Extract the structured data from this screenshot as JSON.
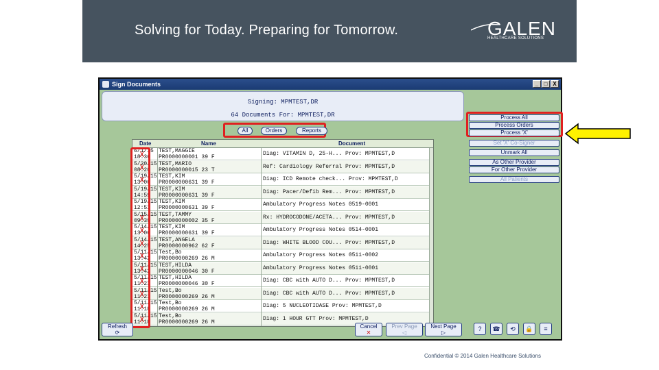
{
  "slide": {
    "tagline": "Solving for Today. Preparing for Tomorrow.",
    "logo_word": "GALEN",
    "logo_sub": "HEALTHCARE SOLUTIONS",
    "footer": "Confidential © 2014 Galen Healthcare Solutions"
  },
  "window": {
    "title": "Sign Documents",
    "controls": [
      "_",
      "□",
      "X"
    ],
    "signing_label": "Signing: MPMTEST,DR",
    "doc_count": "64 Documents For: MPMTEST,DR"
  },
  "filters": [
    "All",
    "Orders",
    "Reports"
  ],
  "grid": {
    "columns": [
      "Date",
      "Name",
      "Document"
    ],
    "rows": [
      {
        "x": "X",
        "date": "6/1/15",
        "time": "18:36",
        "name": "TEST,MAGGIE",
        "id": "PR0000000001 39 F",
        "doc": "Diag:  VITAMIN D, 25-H... Prov: MPMTEST,D"
      },
      {
        "x": "X",
        "date": "5/20/15",
        "time": "08:20",
        "name": "TEST,MARIO",
        "id": "PR0000000015 23 T",
        "doc": "Ref:  Cardiology Referral Prov: MPMTEST,D"
      },
      {
        "x": "X",
        "date": "5/19/15",
        "time": "13:06",
        "name": "TEST,KIM",
        "id": "PR0000000631 39 F",
        "doc": "Diag:  ICD Remote check... Prov: MPMTEST,D"
      },
      {
        "x": "",
        "date": "5/19/15",
        "time": "14:59",
        "name": "TEST,KIM",
        "id": "PR0000000631 39 F",
        "doc": "Diag:  Pacer/Defib Rem... Prov: MPMTEST,D"
      },
      {
        "x": "",
        "date": "5/19/15",
        "time": "12:51",
        "name": "TEST,KIM",
        "id": "PR0000000631 39 F",
        "doc": "Ambulatory  Progress Notes 0519-0001"
      },
      {
        "x": "X",
        "date": "5/15/15",
        "time": "09:39",
        "name": "TEST,TAMMY",
        "id": "PR0000000002 35 F",
        "doc": "Rx:  HYDROCODONE/ACETA... Prov: MPMTEST,D"
      },
      {
        "x": "X",
        "date": "5/14/15",
        "time": "13:06",
        "name": "TEST,KIM",
        "id": "PR0000000631 39 F",
        "doc": "Ambulatory  Progress Notes 0514-0001"
      },
      {
        "x": "X",
        "date": "5/14/15",
        "time": "14:25",
        "name": "TEST,ANGELA",
        "id": "PR0000000962 62 F",
        "doc": "Diag:  WHITE BLOOD COU... Prov: MPMTEST,D"
      },
      {
        "x": "X",
        "date": "5/11/15",
        "time": "13:42",
        "name": "Test,Bo",
        "id": "PR0000000269 26 M",
        "doc": "Ambulatory  Progress Notes 0511-0002"
      },
      {
        "x": "X",
        "date": "5/11/15",
        "time": "13:42",
        "name": "TEST,HILDA",
        "id": "PR0000000046 30 F",
        "doc": "Ambulatory  Progress Notes 0511-0001"
      },
      {
        "x": "X",
        "date": "5/11/15",
        "time": "11:23",
        "name": "TEST,HILDA",
        "id": "PR0000000046 30 F",
        "doc": "Diag:  CBC with AUTO D... Prov: MPMTEST,D"
      },
      {
        "x": "X",
        "date": "5/11/15",
        "time": "11:21",
        "name": "Test,Bo",
        "id": "PR0000000269 26 M",
        "doc": "Diag:  CBC with AUTO D... Prov: MPMTEST,D"
      },
      {
        "x": "X",
        "date": "5/11/15",
        "time": "11:18",
        "name": "Test,Bo",
        "id": "PR0000000269 26 M",
        "doc": "Diag:  5 NUCLEOTIDASE   Prov: MPMTEST,D"
      },
      {
        "x": "X",
        "date": "5/11/15",
        "time": "11:18",
        "name": "Test,Bo",
        "id": "PR0000000269 26 M",
        "doc": "Diag:  1 HOUR GTT      Prov: MPMTEST,D"
      }
    ]
  },
  "side_buttons": [
    {
      "label": "Process All",
      "faded": false
    },
    {
      "label": "Process Orders",
      "faded": false
    },
    {
      "label": "Process 'X'",
      "faded": false
    },
    {
      "label": "Set 'X' Co-Signer",
      "faded": true
    },
    {
      "label": "Unmark All",
      "faded": false
    },
    {
      "label": "As Other Provider",
      "faded": false
    },
    {
      "label": "For Other Provider",
      "faded": false
    },
    {
      "label": "All Patients",
      "faded": true
    }
  ],
  "bottom": {
    "refresh": "Refresh",
    "cancel": "Cancel",
    "prev_page": "Prev Page",
    "next_page": "Next Page",
    "icons": [
      "?",
      "☎",
      "⟲",
      "🔒",
      "≡"
    ]
  },
  "colors": {
    "banner": "#46535f",
    "highlight": "#e02020",
    "arrow_fill": "#fff200",
    "panel_green": "#a6c79a"
  }
}
